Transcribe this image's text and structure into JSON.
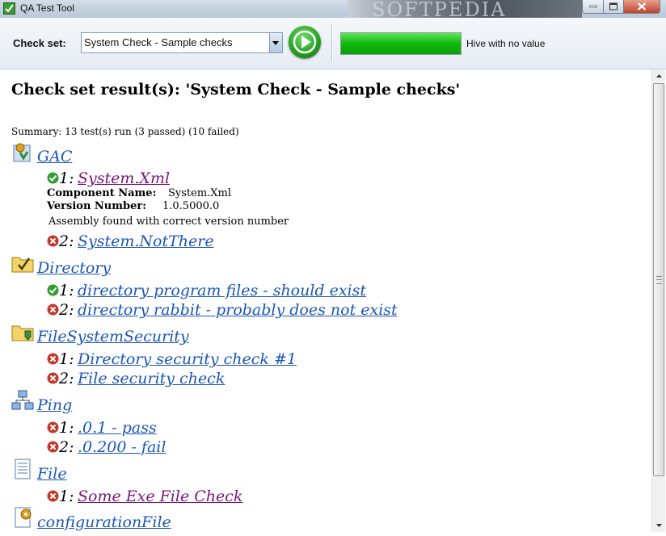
{
  "window": {
    "title": "QA Test Tool",
    "watermark": "SOFTPEDIA"
  },
  "toolbar": {
    "check_set_label": "Check set:",
    "check_set_value": "System Check - Sample checks",
    "progress_percent": 100,
    "status_text": "Hive with no value"
  },
  "results": {
    "title": "Check set result(s): 'System Check - Sample checks'",
    "summary": "Summary: 13 test(s) run (3 passed) (10 failed)",
    "groups": [
      {
        "name": "GAC",
        "icon": "gac-icon",
        "items": [
          {
            "num": "1:",
            "label": "System.Xml",
            "status": "pass",
            "visited": true
          },
          {
            "num": "2:",
            "label": "System.NotThere",
            "status": "fail",
            "visited": false
          }
        ],
        "details": {
          "component_label": "Component Name:",
          "component_value": "System.Xml",
          "version_label": "Version Number:",
          "version_value": "1.0.5000.0",
          "message": "Assembly found with correct version number"
        }
      },
      {
        "name": "Directory",
        "icon": "directory-icon",
        "items": [
          {
            "num": "1:",
            "label": "directory program files - should exist",
            "status": "pass",
            "visited": false
          },
          {
            "num": "2:",
            "label": "directory rabbit - probably does not exist",
            "status": "fail",
            "visited": false
          }
        ]
      },
      {
        "name": "FileSystemSecurity",
        "icon": "folder-security-icon",
        "items": [
          {
            "num": "1:",
            "label": "Directory security check #1",
            "status": "fail",
            "visited": false
          },
          {
            "num": "2:",
            "label": "File security check",
            "status": "fail",
            "visited": false
          }
        ]
      },
      {
        "name": "Ping",
        "icon": "network-icon",
        "items": [
          {
            "num": "1:",
            "label": ".0.1 - pass",
            "status": "fail",
            "visited": false
          },
          {
            "num": "2:",
            "label": ".0.200 - fail",
            "status": "fail",
            "visited": false
          }
        ]
      },
      {
        "name": "File",
        "icon": "document-icon",
        "items": [
          {
            "num": "1:",
            "label": "Some Exe File Check",
            "status": "fail",
            "visited": true
          }
        ]
      },
      {
        "name": "configurationFile",
        "icon": "config-file-icon",
        "items": []
      }
    ]
  },
  "colors": {
    "link": "#1a56b8",
    "visited_link": "#7a167a",
    "pass": "#2e9e2e",
    "fail": "#c0392b",
    "progress": "#10b80c"
  }
}
